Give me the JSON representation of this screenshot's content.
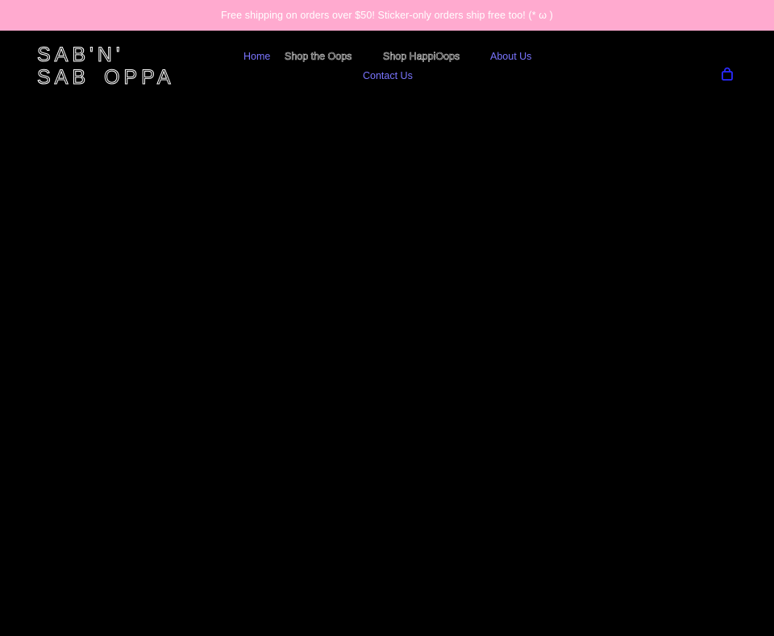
{
  "announcement": {
    "text": "Free shipping on orders over $50! Sticker-only orders ship free too! (* ω )"
  },
  "header": {
    "logo_text": "SAB'N' SAB OPPA",
    "nav": {
      "home": "Home",
      "shop_the_oops": "Shop the Oops",
      "shop_happioops": "Shop HappiOops",
      "about_us": "About Us",
      "contact_us": "Contact Us"
    },
    "cart_icon": "shopping-bag-icon"
  },
  "colors": {
    "announcement_bg": "#ffaacf",
    "page_bg": "#000000",
    "link": "#7a75ff",
    "cart_icon": "#2a2aff"
  }
}
